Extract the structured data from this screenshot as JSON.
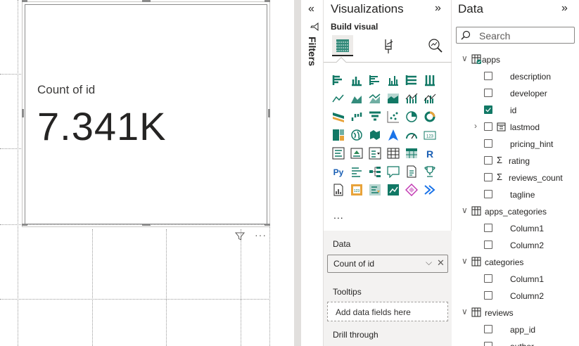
{
  "card": {
    "label": "Count of id",
    "value": "7.341K"
  },
  "filters": {
    "collapse_glyph": "«",
    "label": "Filters"
  },
  "visualizations": {
    "title": "Visualizations",
    "expand_glyph": "»",
    "build_visual_label": "Build visual",
    "more_label": "...",
    "wells": {
      "data_label": "Data",
      "data_field": "Count of id",
      "tooltips_label": "Tooltips",
      "tooltips_placeholder": "Add data fields here",
      "drillthrough_label": "Drill through"
    },
    "accent": "#117865"
  },
  "data_pane": {
    "title": "Data",
    "expand_glyph": "»",
    "search_placeholder": "Search",
    "tables": [
      {
        "name": "apps",
        "expanded": true,
        "fields": [
          {
            "name": "description",
            "checked": false
          },
          {
            "name": "developer",
            "checked": false
          },
          {
            "name": "id",
            "checked": true
          },
          {
            "name": "lastmod",
            "checked": false,
            "type": "date-hierarchy"
          },
          {
            "name": "pricing_hint",
            "checked": false
          },
          {
            "name": "rating",
            "checked": false,
            "type": "sum"
          },
          {
            "name": "reviews_count",
            "checked": false,
            "type": "sum"
          },
          {
            "name": "tagline",
            "checked": false
          }
        ]
      },
      {
        "name": "apps_categories",
        "expanded": true,
        "fields": [
          {
            "name": "Column1",
            "checked": false
          },
          {
            "name": "Column2",
            "checked": false
          }
        ]
      },
      {
        "name": "categories",
        "expanded": true,
        "fields": [
          {
            "name": "Column1",
            "checked": false
          },
          {
            "name": "Column2",
            "checked": false
          }
        ]
      },
      {
        "name": "reviews",
        "expanded": true,
        "fields": [
          {
            "name": "app_id",
            "checked": false
          },
          {
            "name": "author",
            "checked": false
          }
        ]
      }
    ]
  }
}
